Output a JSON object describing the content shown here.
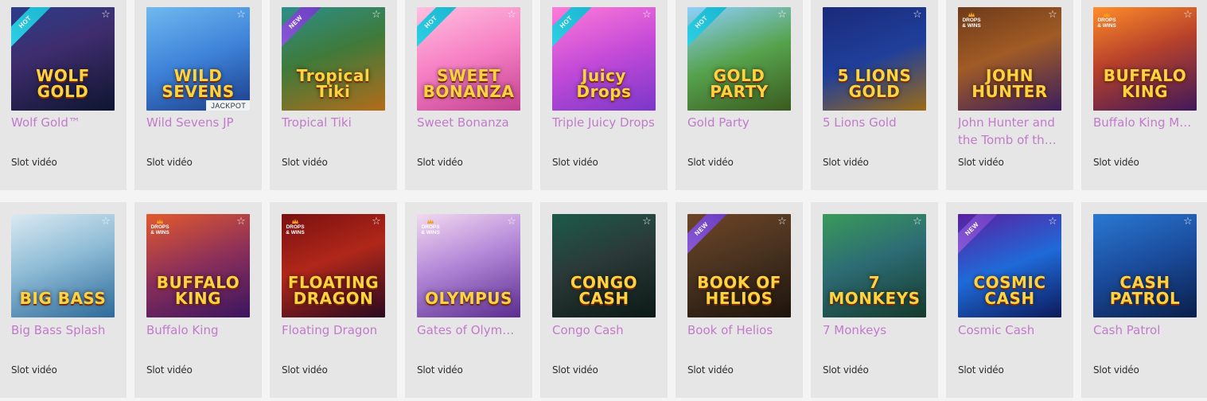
{
  "subtitle_label": "Slot vidéo",
  "colors": {
    "title": "#c27acb",
    "card_bg": "#e6e6e6",
    "hot_ribbon": "#2fd2e6",
    "new_ribbon": "#8b5bd8"
  },
  "rows": [
    {
      "games": [
        {
          "title": "Wolf Gold™",
          "subtitle": "Slot vidéo",
          "badge": "HOT",
          "logo": "WOLF GOLD",
          "icon": "star-icon",
          "bg": "linear-gradient(160deg,#2a3d8a 0%,#3f2d6e 40%,#0e1530 100%)"
        },
        {
          "title": "Wild Sevens JP",
          "subtitle": "Slot vidéo",
          "jackpot": "JACKPOT",
          "logo": "WILD SEVENS",
          "icon": "star-icon",
          "bg": "linear-gradient(160deg,#6fb9f0 0%,#3d82d8 50%,#1c3c88 100%)"
        },
        {
          "title": "Tropical Tiki",
          "subtitle": "Slot vidéo",
          "badge": "NEW",
          "logo": "Tropical Tiki",
          "icon": "star-icon",
          "bg": "linear-gradient(160deg,#2d8f8a 0%,#3f7a3a 45%,#b36c1a 100%)"
        },
        {
          "title": "Sweet Bonanza",
          "subtitle": "Slot vidéo",
          "badge": "HOT",
          "logo": "SWEET BONANZA",
          "icon": "star-icon",
          "bg": "linear-gradient(160deg,#ffc0e0 0%,#f67ec3 50%,#c2418f 100%)"
        },
        {
          "title": "Triple Juicy Drops",
          "subtitle": "Slot vidéo",
          "badge": "HOT",
          "logo": "Juicy Drops",
          "icon": "star-icon",
          "bg": "linear-gradient(160deg,#ff7ad8 0%,#c34ad8 50%,#7a37c9 100%)"
        },
        {
          "title": "Gold Party",
          "subtitle": "Slot vidéo",
          "badge": "HOT",
          "logo": "GOLD PARTY",
          "icon": "star-icon",
          "bg": "linear-gradient(160deg,#8ed0ff 0%,#56a24c 50%,#3a5a1f 100%)"
        },
        {
          "title": "5 Lions Gold",
          "subtitle": "Slot vidéo",
          "logo": "5 LIONS GOLD",
          "icon": "star-icon",
          "bg": "linear-gradient(160deg,#1a2a7a 0%,#203f9a 50%,#9b6b16 100%)"
        },
        {
          "title": "John Hunter and the Tomb of the Scarab Queen",
          "subtitle": "Slot vidéo",
          "drops": "DROPS & WINS",
          "logo": "JOHN HUNTER",
          "icon": "star-icon",
          "bg": "linear-gradient(160deg,#6e3a1a 0%,#a05b25 45%,#3b1e5e 100%)"
        },
        {
          "title": "Buffalo King Megaways",
          "subtitle": "Slot vidéo",
          "drops": "DROPS & WINS",
          "logo": "BUFFALO KING",
          "icon": "star-icon",
          "bg": "linear-gradient(160deg,#ff8c2a 0%,#b6412b 45%,#40185a 100%)"
        }
      ]
    },
    {
      "games": [
        {
          "title": "Big Bass Splash",
          "subtitle": "Slot vidéo",
          "logo": "BIG BASS",
          "icon": "star-icon",
          "bg": "linear-gradient(160deg,#dbe9f2 0%,#8fbcd6 45%,#2d6a9a 100%)"
        },
        {
          "title": "Buffalo King",
          "subtitle": "Slot vidéo",
          "drops": "DROPS & WINS",
          "logo": "BUFFALO KING",
          "icon": "star-icon",
          "bg": "linear-gradient(160deg,#e25a2d 0%,#8b2f5a 50%,#3a1560 100%)"
        },
        {
          "title": "Floating Dragon",
          "subtitle": "Slot vidéo",
          "drops": "DROPS & WINS",
          "logo": "FLOATING DRAGON",
          "icon": "star-icon",
          "bg": "linear-gradient(160deg,#7a1010 0%,#b0271a 45%,#2a0a20 100%)"
        },
        {
          "title": "Gates of Olympus",
          "subtitle": "Slot vidéo",
          "drops": "DROPS & WINS",
          "logo": "OLYMPUS",
          "icon": "star-icon",
          "bg": "linear-gradient(160deg,#f2d9f0 0%,#b488d8 45%,#5a2d8f 100%)"
        },
        {
          "title": "Congo Cash",
          "subtitle": "Slot vidéo",
          "logo": "CONGO CASH",
          "icon": "star-icon",
          "bg": "linear-gradient(160deg,#1c5a4a 0%,#2b3a38 45%,#0b1a16 100%)"
        },
        {
          "title": "Book of Helios",
          "subtitle": "Slot vidéo",
          "badge": "NEW",
          "logo": "BOOK OF HELIOS",
          "icon": "star-icon",
          "bg": "linear-gradient(160deg,#6e4526 0%,#4a3320 45%,#1e140c 100%)"
        },
        {
          "title": "7 Monkeys",
          "subtitle": "Slot vidéo",
          "logo": "7 MONKEYS",
          "icon": "star-icon",
          "bg": "linear-gradient(160deg,#3a9a5a 0%,#2d6c74 45%,#153a2c 100%)"
        },
        {
          "title": "Cosmic Cash",
          "subtitle": "Slot vidéo",
          "badge": "NEW",
          "logo": "COSMIC CASH",
          "icon": "star-icon",
          "bg": "linear-gradient(160deg,#5a1fa0 0%,#1f6ad8 50%,#0c1a5a 100%)"
        },
        {
          "title": "Cash Patrol",
          "subtitle": "Slot vidéo",
          "logo": "CASH PATROL",
          "icon": "star-icon",
          "bg": "linear-gradient(160deg,#2a78d2 0%,#1a4a9a 50%,#0a1f4a 100%)"
        }
      ]
    }
  ]
}
